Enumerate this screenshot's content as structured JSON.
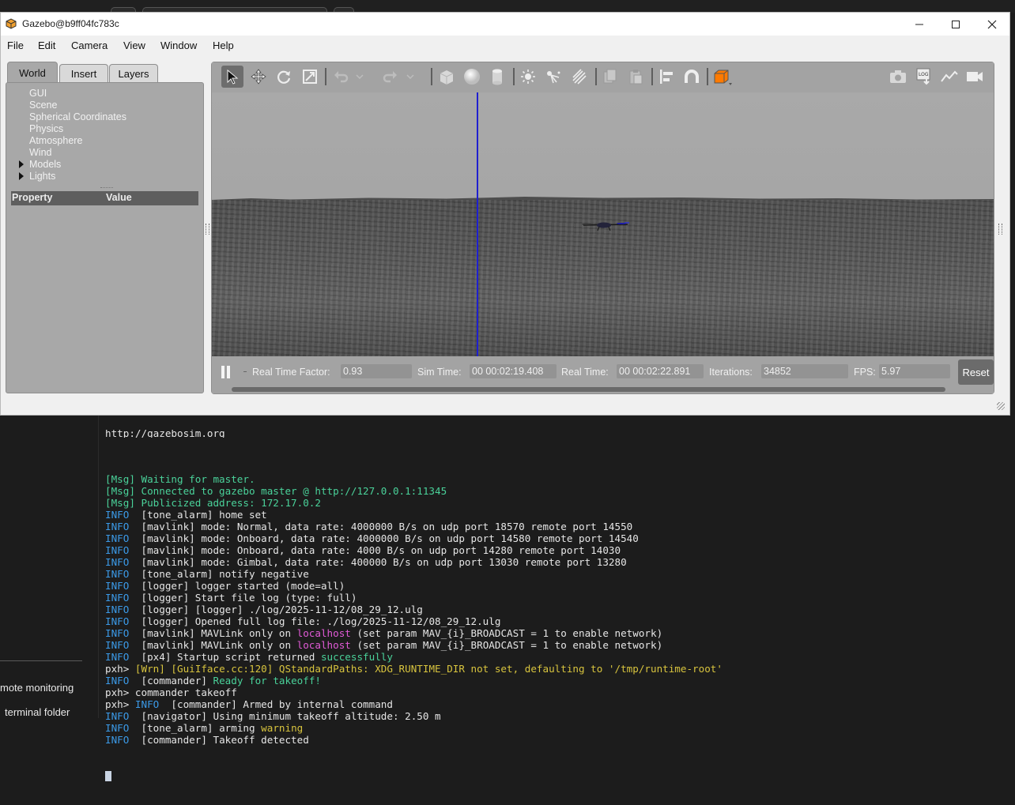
{
  "gazebo": {
    "title": "Gazebo@b9ff04fc783c",
    "menu": [
      "File",
      "Edit",
      "Camera",
      "View",
      "Window",
      "Help"
    ],
    "tabs": [
      "World",
      "Insert",
      "Layers"
    ],
    "tree": [
      "GUI",
      "Scene",
      "Spherical Coordinates",
      "Physics",
      "Atmosphere",
      "Wind",
      "Models",
      "Lights"
    ],
    "property_header": {
      "property": "Property",
      "value": "Value"
    },
    "status": {
      "rtf_label": "Real Time Factor:",
      "rtf_value": "0.93",
      "sim_label": "Sim Time:",
      "sim_value": "00 00:02:19.408",
      "real_label": "Real Time:",
      "real_value": "00 00:02:22.891",
      "iter_label": "Iterations:",
      "iter_value": "34852",
      "fps_label": "FPS:",
      "fps_value": "5.97",
      "reset_label": "Reset"
    },
    "toolbar_icons": [
      "select-arrow-icon",
      "translate-icon",
      "rotate-icon",
      "scale-icon",
      "undo-icon",
      "undo-dropdown-icon",
      "redo-icon",
      "redo-dropdown-icon",
      "box-icon",
      "sphere-icon",
      "cylinder-icon",
      "point-light-icon",
      "spot-light-icon",
      "directional-light-icon",
      "copy-icon",
      "paste-icon",
      "align-icon",
      "snap-icon",
      "view-angle-icon",
      "screenshot-icon",
      "log-icon",
      "plot-icon",
      "record-video-icon"
    ]
  },
  "sidebar": {
    "items": [
      "mote monitoring",
      "terminal folder"
    ]
  },
  "terminal": {
    "top_line": "http://gazebosim.org",
    "lines": [
      [
        {
          "t": "",
          "c": "c-white"
        }
      ],
      [
        {
          "t": "[Msg] Waiting for master.",
          "c": "c-green"
        }
      ],
      [
        {
          "t": "[Msg] Connected to gazebo master @ http://127.0.0.1:11345",
          "c": "c-green"
        }
      ],
      [
        {
          "t": "[Msg] Publicized address: 172.17.0.2",
          "c": "c-green"
        }
      ],
      [
        {
          "t": "INFO  ",
          "c": "c-blue"
        },
        {
          "t": "[tone_alarm] home set",
          "c": "c-white"
        }
      ],
      [
        {
          "t": "INFO  ",
          "c": "c-blue"
        },
        {
          "t": "[mavlink] mode: Normal, data rate: 4000000 B/s on udp port 18570 remote port 14550",
          "c": "c-white"
        }
      ],
      [
        {
          "t": "INFO  ",
          "c": "c-blue"
        },
        {
          "t": "[mavlink] mode: Onboard, data rate: 4000000 B/s on udp port 14580 remote port 14540",
          "c": "c-white"
        }
      ],
      [
        {
          "t": "INFO  ",
          "c": "c-blue"
        },
        {
          "t": "[mavlink] mode: Onboard, data rate: 4000 B/s on udp port 14280 remote port 14030",
          "c": "c-white"
        }
      ],
      [
        {
          "t": "INFO  ",
          "c": "c-blue"
        },
        {
          "t": "[mavlink] mode: Gimbal, data rate: 400000 B/s on udp port 13030 remote port 13280",
          "c": "c-white"
        }
      ],
      [
        {
          "t": "INFO  ",
          "c": "c-blue"
        },
        {
          "t": "[tone_alarm] notify negative",
          "c": "c-white"
        }
      ],
      [
        {
          "t": "INFO  ",
          "c": "c-blue"
        },
        {
          "t": "[logger] logger started (mode=all)",
          "c": "c-white"
        }
      ],
      [
        {
          "t": "INFO  ",
          "c": "c-blue"
        },
        {
          "t": "[logger] Start file log (type: full)",
          "c": "c-white"
        }
      ],
      [
        {
          "t": "INFO  ",
          "c": "c-blue"
        },
        {
          "t": "[logger] [logger] ./log/2025-11-12/08_29_12.ulg",
          "c": "c-white"
        }
      ],
      [
        {
          "t": "INFO  ",
          "c": "c-blue"
        },
        {
          "t": "[logger] Opened full log file: ./log/2025-11-12/08_29_12.ulg",
          "c": "c-white"
        }
      ],
      [
        {
          "t": "INFO  ",
          "c": "c-blue"
        },
        {
          "t": "[mavlink] MAVLink only on ",
          "c": "c-white"
        },
        {
          "t": "localhost",
          "c": "c-magenta"
        },
        {
          "t": " (set param MAV_{i}_BROADCAST = 1 to enable network)",
          "c": "c-white"
        }
      ],
      [
        {
          "t": "INFO  ",
          "c": "c-blue"
        },
        {
          "t": "[mavlink] MAVLink only on ",
          "c": "c-white"
        },
        {
          "t": "localhost",
          "c": "c-magenta"
        },
        {
          "t": " (set param MAV_{i}_BROADCAST = 1 to enable network)",
          "c": "c-white"
        }
      ],
      [
        {
          "t": "INFO  ",
          "c": "c-blue"
        },
        {
          "t": "[px4] Startup script returned ",
          "c": "c-white"
        },
        {
          "t": "successfully",
          "c": "c-green"
        }
      ],
      [
        {
          "t": "pxh> ",
          "c": "c-white"
        },
        {
          "t": "[Wrn] [GuiIface.cc:120] QStandardPaths: XDG_RUNTIME_DIR not set, defaulting to '/tmp/runtime-root'",
          "c": "c-yellow"
        }
      ],
      [
        {
          "t": "INFO  ",
          "c": "c-blue"
        },
        {
          "t": "[commander] ",
          "c": "c-white"
        },
        {
          "t": "Ready for takeoff!",
          "c": "c-green"
        }
      ],
      [
        {
          "t": "pxh> commander takeoff",
          "c": "c-white"
        }
      ],
      [
        {
          "t": "pxh> ",
          "c": "c-white"
        },
        {
          "t": "INFO  ",
          "c": "c-blue"
        },
        {
          "t": "[commander] Armed by internal command",
          "c": "c-white"
        }
      ],
      [
        {
          "t": "INFO  ",
          "c": "c-blue"
        },
        {
          "t": "[navigator] Using minimum takeoff altitude: 2.50 m",
          "c": "c-white"
        }
      ],
      [
        {
          "t": "INFO  ",
          "c": "c-blue"
        },
        {
          "t": "[tone_alarm] arming ",
          "c": "c-white"
        },
        {
          "t": "warning",
          "c": "c-yellow"
        }
      ],
      [
        {
          "t": "INFO  ",
          "c": "c-blue"
        },
        {
          "t": "[commander] Takeoff detected",
          "c": "c-white"
        }
      ]
    ]
  }
}
